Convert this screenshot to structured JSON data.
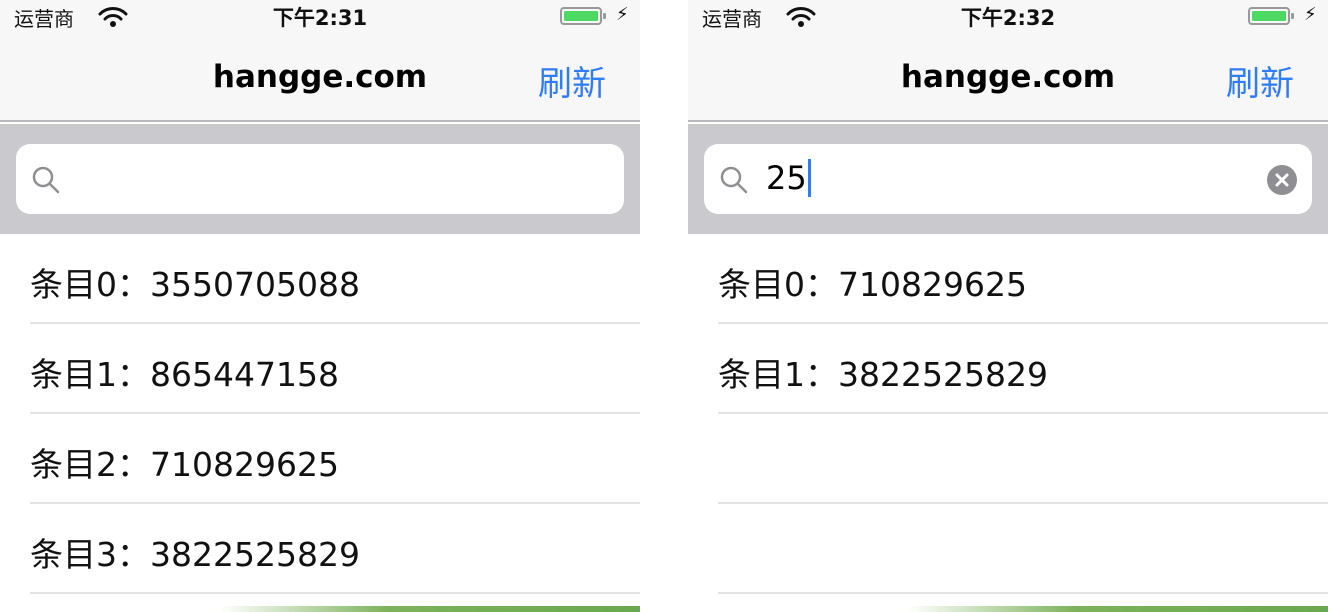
{
  "screens": [
    {
      "status": {
        "carrier": "运营商",
        "time": "下午2:31",
        "charge": "⚡"
      },
      "nav": {
        "title": "hangge.com",
        "refresh": "刷新"
      },
      "search": {
        "value": ""
      },
      "rows": [
        {
          "label": "条目0：3550705088"
        },
        {
          "label": "条目1：865447158"
        },
        {
          "label": "条目2：710829625"
        },
        {
          "label": "条目3：3822525829"
        }
      ]
    },
    {
      "status": {
        "carrier": "运营商",
        "time": "下午2:32",
        "charge": "⚡"
      },
      "nav": {
        "title": "hangge.com",
        "refresh": "刷新"
      },
      "search": {
        "value": "25"
      },
      "rows": [
        {
          "label": "条目0：710829625"
        },
        {
          "label": "条目1：3822525829"
        },
        {
          "label": ""
        },
        {
          "label": ""
        }
      ]
    }
  ],
  "colors": {
    "tint": "#2f7cf6",
    "search_bar_bg": "#c9c9ce",
    "battery": "#4cd964"
  },
  "icons": [
    "wifi-icon",
    "battery-icon",
    "charge-icon",
    "search-icon",
    "clear-icon"
  ]
}
